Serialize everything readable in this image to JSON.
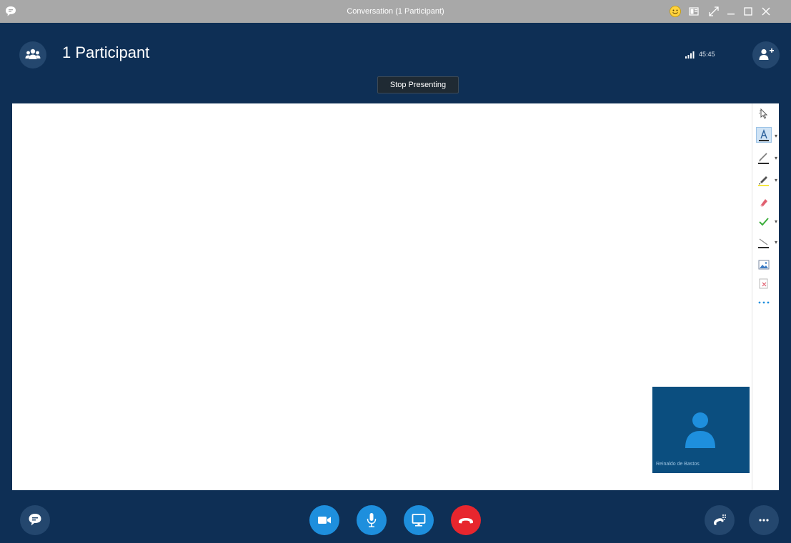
{
  "window": {
    "title": "Conversation (1 Participant)"
  },
  "header": {
    "participants_label": "1 Participant",
    "call_timer": "45:45",
    "stop_presenting_label": "Stop Presenting"
  },
  "self_video": {
    "name": "Reinaldo de Bastos"
  },
  "icons": {
    "app": "chat-bubble-icon",
    "emoji": "smiley-icon",
    "layout": "layout-icon",
    "fullscreen": "expand-icon",
    "minimize": "minimize-icon",
    "maximize": "maximize-icon",
    "close": "close-icon",
    "participants": "people-icon",
    "signal": "signal-icon",
    "add_people": "add-person-icon",
    "avatar": "person-avatar-icon"
  },
  "toolbar_tools": [
    {
      "name": "select-tool",
      "icon": "pointer-icon"
    },
    {
      "name": "text-tool",
      "icon": "text-icon"
    },
    {
      "name": "pen-tool",
      "icon": "pen-icon"
    },
    {
      "name": "highlighter-tool",
      "icon": "highlighter-icon"
    },
    {
      "name": "eraser-tool",
      "icon": "eraser-icon"
    },
    {
      "name": "stamp-tool",
      "icon": "checkmark-icon"
    },
    {
      "name": "shape-tool",
      "icon": "line-icon"
    },
    {
      "name": "insert-image-tool",
      "icon": "image-icon"
    },
    {
      "name": "delete-tool",
      "icon": "delete-annotations-icon"
    },
    {
      "name": "more-tools",
      "icon": "ellipsis-icon"
    }
  ],
  "colors": {
    "header_bg": "#0e2f55",
    "titlebar_bg": "#a8a8a8",
    "accent_blue": "#1e8fdd",
    "hangup_red": "#e7262e",
    "self_video_bg": "#0b4e7f"
  },
  "bottom": {
    "chat_icon": "chat-bubble-icon",
    "video_icon": "video-camera-icon",
    "mic_icon": "microphone-icon",
    "present_icon": "monitor-icon",
    "hangup_icon": "phone-hangup-icon",
    "call_controls_icon": "dialpad-phone-icon",
    "more_icon": "ellipsis-icon"
  }
}
